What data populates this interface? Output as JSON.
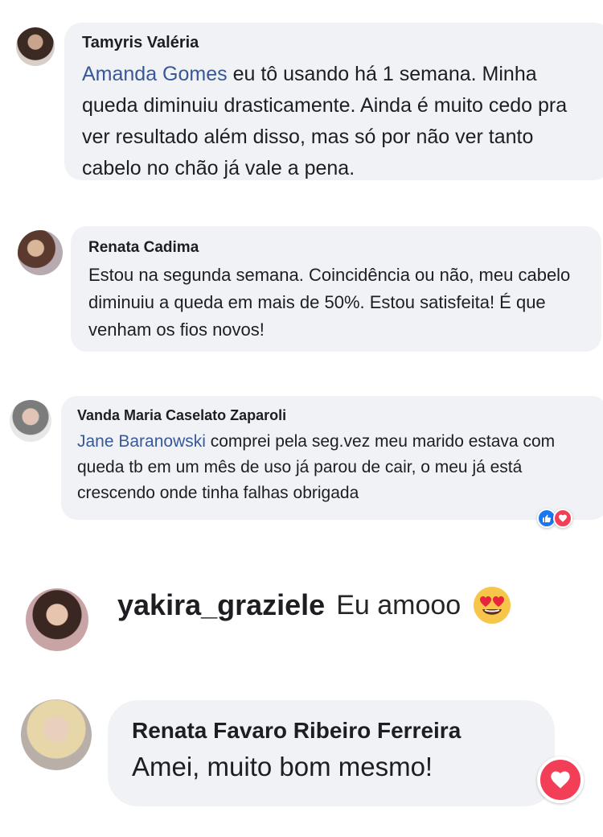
{
  "comments": [
    {
      "author": "Tamyris Valéria",
      "mention": "Amanda Gomes",
      "text": " eu tô usando há 1 semana. Minha queda diminuiu drasticamente. Ainda é muito cedo pra ver resultado além disso, mas só por não ver tanto cabelo no chão já vale a pena."
    },
    {
      "author": "Renata Cadima",
      "text": "Estou na segunda semana. Coincidência ou não, meu cabelo diminuiu a queda em mais de 50%. Estou satisfeita! É que venham os fios novos!"
    },
    {
      "author": "Vanda Maria Caselato Zaparoli",
      "mention": "Jane Baranowski",
      "text": " comprei pela seg.vez meu marido estava com queda tb em um mês de uso já parou de cair, o meu já está crescendo onde tinha falhas obrigada",
      "reactions": [
        "like-icon",
        "love-icon"
      ]
    },
    {
      "author": "yakira_graziele",
      "text": "Eu amooo",
      "emoji": "heart-eyes-emoji-icon"
    },
    {
      "author": "Renata Favaro Ribeiro Ferreira",
      "text": "Amei, muito bom mesmo!",
      "reactions": [
        "love-icon"
      ]
    }
  ],
  "colors": {
    "bubble": "#f0f2f5",
    "mention": "#385898",
    "like": "#1877f2",
    "love": "#f33e58"
  }
}
